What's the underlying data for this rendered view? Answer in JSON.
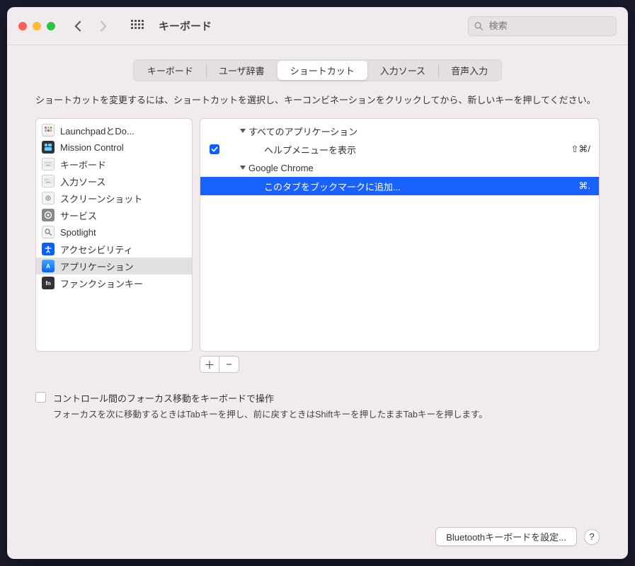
{
  "window": {
    "title": "キーボード",
    "search_placeholder": "検索"
  },
  "tabs": {
    "items": [
      {
        "label": "キーボード"
      },
      {
        "label": "ユーザ辞書"
      },
      {
        "label": "ショートカット",
        "selected": true
      },
      {
        "label": "入力ソース"
      },
      {
        "label": "音声入力"
      }
    ]
  },
  "instruction": "ショートカットを変更するには、ショートカットを選択し、キーコンビネーションをクリックしてから、新しいキーを押してください。",
  "categories": [
    {
      "icon": "launchpad-icon",
      "label": "LaunchpadとDo..."
    },
    {
      "icon": "mission-control-icon",
      "label": "Mission Control"
    },
    {
      "icon": "keyboard-icon",
      "label": "キーボード"
    },
    {
      "icon": "input-sources-icon",
      "label": "入力ソース"
    },
    {
      "icon": "screenshot-icon",
      "label": "スクリーンショット"
    },
    {
      "icon": "services-icon",
      "label": "サービス"
    },
    {
      "icon": "spotlight-icon",
      "label": "Spotlight"
    },
    {
      "icon": "accessibility-icon",
      "label": "アクセシビリティ"
    },
    {
      "icon": "applications-icon",
      "label": "アプリケーション",
      "selected": true
    },
    {
      "icon": "function-keys-icon",
      "label": "ファンクションキー"
    }
  ],
  "shortcuts": [
    {
      "type": "group",
      "label": "すべてのアプリケーション"
    },
    {
      "type": "item",
      "checked": true,
      "label": "ヘルプメニューを表示",
      "keys": "⇧⌘/"
    },
    {
      "type": "group",
      "label": "Google Chrome"
    },
    {
      "type": "item",
      "selected": true,
      "label": "このタブをブックマークに追加...",
      "keys": "⌘."
    }
  ],
  "focus": {
    "title": "コントロール間のフォーカス移動をキーボードで操作",
    "desc": "フォーカスを次に移動するときはTabキーを押し、前に戻すときはShiftキーを押したままTabキーを押します。"
  },
  "footer": {
    "bluetooth": "Bluetoothキーボードを設定...",
    "help": "?"
  },
  "buttons": {
    "add": "＋",
    "remove": "−"
  }
}
